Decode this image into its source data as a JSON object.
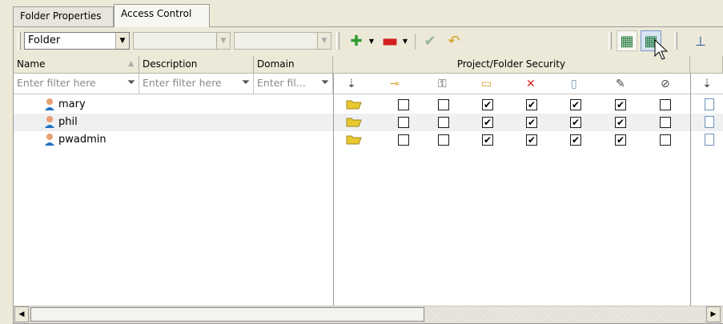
{
  "tabs": [
    {
      "label": "Folder Properties",
      "active": false
    },
    {
      "label": "Access Control",
      "active": true
    }
  ],
  "toolbar": {
    "type_combo_value": "Folder",
    "add_icon": "plus-icon",
    "remove_icon": "minus-icon",
    "apply_icon": "checkmark-icon",
    "reset_icon": "undo-icon",
    "export_icon": "excel-export-icon",
    "import_icon": "excel-import-icon",
    "pin_icon": "pin-icon"
  },
  "columns": {
    "name": "Name",
    "description": "Description",
    "domain": "Domain",
    "security_group": "Project/Folder Security"
  },
  "filters": {
    "name_placeholder": "Enter filter here",
    "description_placeholder": "Enter filter here",
    "domain_placeholder": "Enter fil..."
  },
  "security_columns": [
    "inherit-icon",
    "key-icon",
    "permission-icon",
    "create-folder-icon",
    "delete-icon",
    "read-icon",
    "write-icon",
    "no-access-icon",
    "file-inherit-icon"
  ],
  "users": [
    {
      "name": "mary",
      "perms": [
        false,
        false,
        true,
        true,
        true,
        true,
        false
      ]
    },
    {
      "name": "phil",
      "perms": [
        false,
        false,
        true,
        true,
        true,
        true,
        false
      ]
    },
    {
      "name": "pwadmin",
      "perms": [
        false,
        false,
        true,
        true,
        true,
        true,
        false
      ]
    }
  ],
  "colors": {
    "accent_green": "#2e9b2e",
    "accent_red": "#d42020",
    "folder_yellow": "#e8c830"
  }
}
